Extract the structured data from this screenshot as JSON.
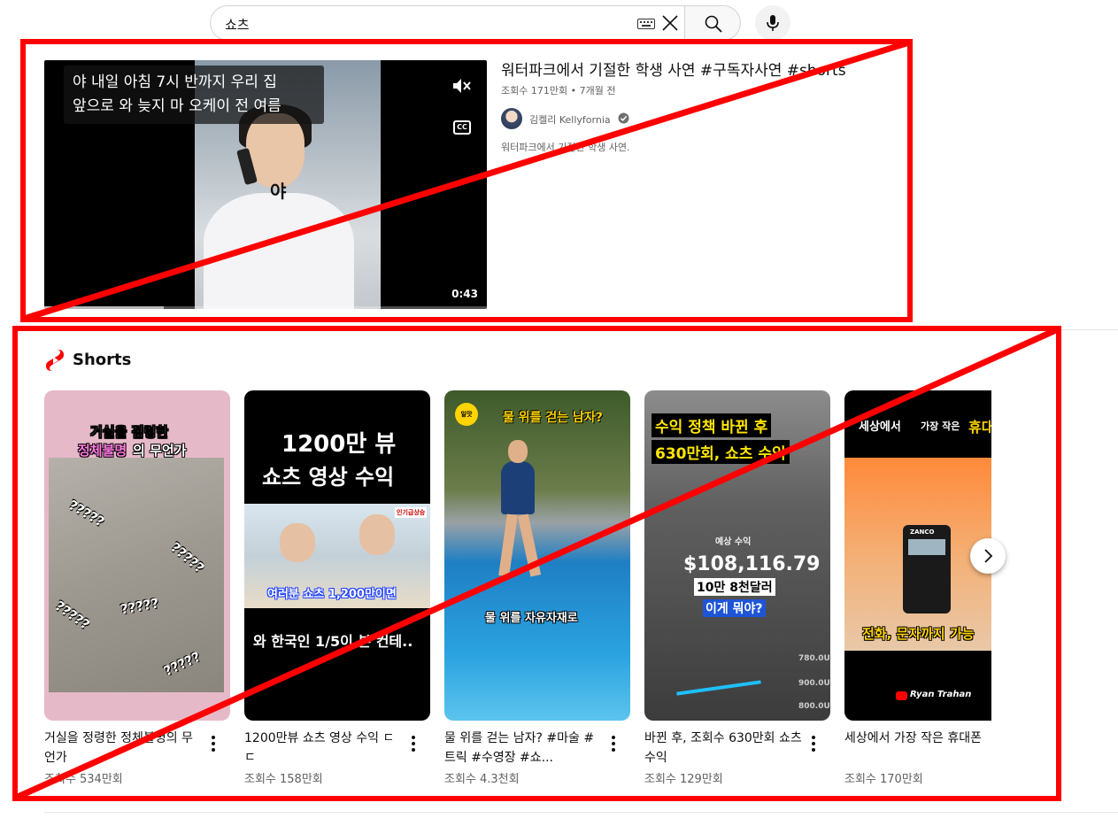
{
  "search": {
    "query": "쇼츠",
    "keyboard_icon": "keyboard-icon",
    "clear_icon": "close-icon",
    "search_icon": "search-icon",
    "mic_icon": "mic-icon"
  },
  "video": {
    "title": "워터파크에서 기절한 학생 사연 #구독자사연 #shorts",
    "views": "조회수 171만회",
    "age": "7개월 전",
    "channel": "김켈리 Kellyfornia",
    "verified_icon": "verified-check-icon",
    "description": "워터파크에서 기절한 학생 사연.",
    "duration": "0:43",
    "progress_fraction": 0.27,
    "caption_lines": [
      "야 내일 아침 7시 반까지 우리 집",
      "앞으로 와 늦지 마 오케이 전 여름"
    ],
    "thumb_overlay": "야"
  },
  "shorts": {
    "heading": "Shorts",
    "logo_icon": "shorts-logo-icon",
    "accent_color": "#ff0000",
    "items": [
      {
        "title": "거실을 정령한 정체불명의 무언가",
        "views": "조회수 534만회",
        "overlay_line1": "거실을 점령한",
        "overlay_line2a": "정체불명",
        "overlay_line2b": "의 무언가",
        "q1": "?????",
        "q2": "?????",
        "q3": "?????",
        "q4": "?????",
        "q5": "?????"
      },
      {
        "title": "1200만뷰 쇼츠 영상 수익 ㄷㄷ",
        "views": "조회수 158만회",
        "overlay_line1": "1200만 뷰",
        "overlay_line2": "쇼츠 영상 수익",
        "overlay_mid": "여러분 쇼츠 1,200만이면",
        "overlay_bottom": "와 한국인 1/5이 본 컨테..",
        "overlay_tag": "인기급상승"
      },
      {
        "title": "물 위를 걷는 남자? #마술 #트릭 #수영장 #쇼...",
        "views": "조회수 4.3천회",
        "overlay_top": "물 위를 걷는 남자?",
        "overlay_bottom": "물 위를 자유자재로",
        "badge": "일맛"
      },
      {
        "title": "바뀐 후, 조회수 630만회 쇼츠 수익",
        "views": "조회수 129만회",
        "overlay_line1": "수익 정책 바뀐 후",
        "overlay_line2": "630만회, 쇼츠 수익",
        "overlay_label": "예상 수익",
        "overlay_amount": "$108,116.79",
        "overlay_krw": "10만 8천달러",
        "overlay_q": "이게 뭐야?",
        "axis1": "780.0U",
        "axis2": "900.0U",
        "axis3": "800.0U"
      },
      {
        "title": "세상에서 가장 작은 휴대폰",
        "views": "조회수 170만회",
        "overlay_top_a": "세상에서",
        "overlay_top_b": "가장 작은",
        "overlay_top_c": "휴대",
        "overlay_bottom": "전화, 문자까지 가능",
        "phone_brand": "ZANCO",
        "credit": "Ryan Trahan"
      }
    ],
    "next_icon": "chevron-right-icon"
  }
}
